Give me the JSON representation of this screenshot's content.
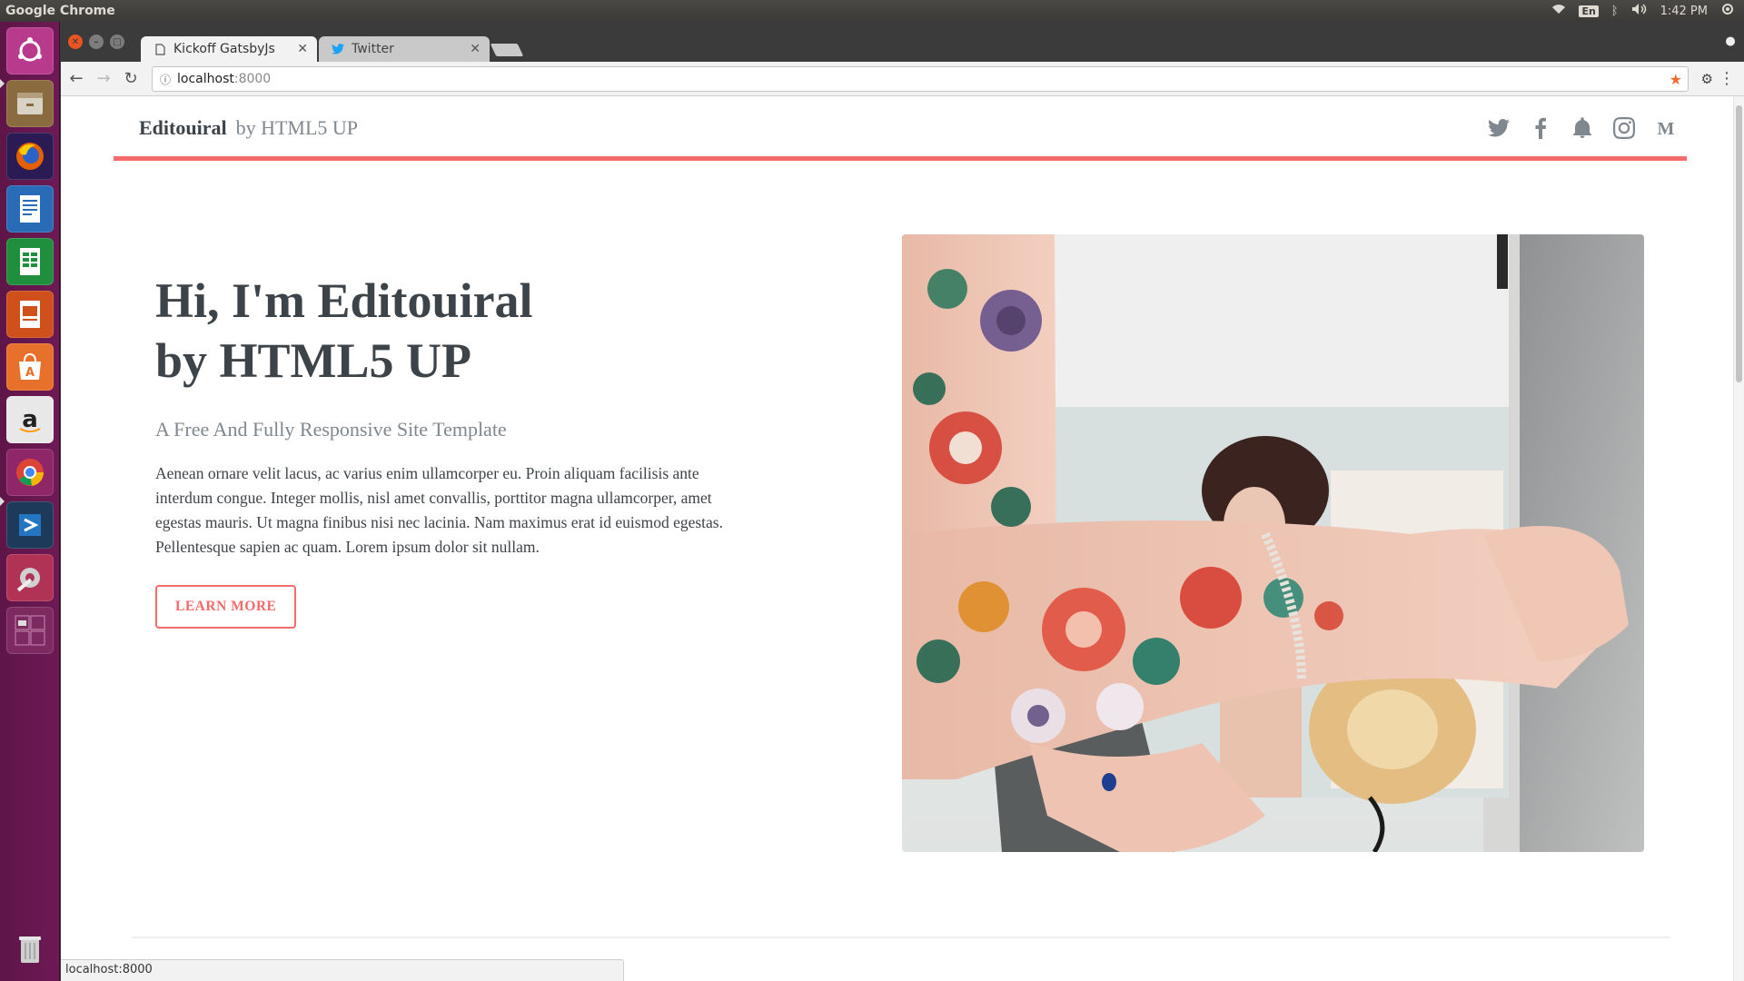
{
  "system": {
    "app_title": "Google Chrome",
    "keyboard_layout": "En",
    "clock": "1:42 PM",
    "indicator_icons": [
      "wifi-icon",
      "bluetooth-icon",
      "volume-icon",
      "power-settings-icon"
    ]
  },
  "launcher": {
    "items": [
      {
        "name": "ubuntu-dash-icon",
        "color": "#b83a8c"
      },
      {
        "name": "files-icon",
        "color": "#8a6b3f"
      },
      {
        "name": "firefox-icon",
        "color": "#e66000"
      },
      {
        "name": "libreoffice-writer-icon",
        "color": "#2a6bb8"
      },
      {
        "name": "libreoffice-calc-icon",
        "color": "#1f8f3e"
      },
      {
        "name": "libreoffice-impress-icon",
        "color": "#d0501b"
      },
      {
        "name": "ubuntu-software-icon",
        "color": "#e7702a"
      },
      {
        "name": "amazon-icon",
        "color": "#e8e8e8"
      },
      {
        "name": "chrome-icon",
        "color": "#4285f4"
      },
      {
        "name": "vscode-icon",
        "color": "#2476c3"
      },
      {
        "name": "system-settings-icon",
        "color": "#a5a5a5"
      },
      {
        "name": "workspace-switcher-icon",
        "color": "#7d2a60"
      },
      {
        "name": "trash-icon",
        "color": "#bdbdbd"
      }
    ]
  },
  "browser": {
    "tabs": [
      {
        "title": "Kickoff GatsbyJs",
        "favicon": "page-icon",
        "active": true
      },
      {
        "title": "Twitter",
        "favicon": "twitter-bird-icon",
        "active": false
      }
    ],
    "url_host": "localhost",
    "url_port": ":8000",
    "status_bar": "localhost:8000"
  },
  "site": {
    "logo_strong": "Editouiral",
    "logo_by": "by HTML5 UP",
    "social": [
      "twitter-icon",
      "facebook-icon",
      "bell-icon",
      "instagram-icon",
      "medium-icon"
    ],
    "headline_line1": "Hi, I'm Editouiral",
    "headline_line2": "by HTML5 UP",
    "tagline": "A Free And Fully Responsive Site Template",
    "intro": "Aenean ornare velit lacus, ac varius enim ullamcorper eu. Proin aliquam facilisis ante interdum congue. Integer mollis, nisl amet convallis, porttitor magna ullamcorper, amet egestas mauris. Ut magna finibus nisi nec lacinia. Nam maximus erat id euismod egestas. Pellentesque sapien ac quam. Lorem ipsum dolor sit nullam.",
    "cta_label": "LEARN MORE",
    "accent_color": "#f56a6a"
  }
}
